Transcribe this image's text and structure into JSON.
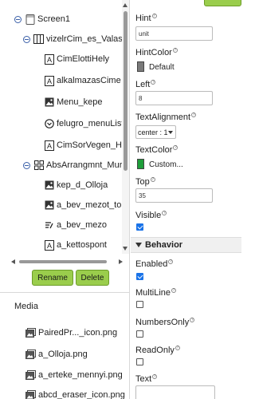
{
  "tree": {
    "screen": {
      "label": "Screen1"
    },
    "nodes": [
      {
        "label": "vizelrCim_es_Valas",
        "icon": "vertical-arrangement-icon",
        "level": 1
      },
      {
        "label": "CimElottiHely",
        "icon": "label-icon",
        "level": 2
      },
      {
        "label": "alkalmazasCime",
        "icon": "label-icon",
        "level": 2
      },
      {
        "label": "Menu_kepe",
        "icon": "image-icon",
        "level": 2
      },
      {
        "label": "felugro_menuListe",
        "icon": "listpicker-icon",
        "level": 2
      },
      {
        "label": "CimSorVegen_He",
        "icon": "label-icon",
        "level": 2
      },
      {
        "label": "AbsArrangmnt_Mur",
        "icon": "absolute-arrangement-icon",
        "level": 1
      },
      {
        "label": "kep_d_Olloja",
        "icon": "image-icon",
        "level": 2
      },
      {
        "label": "a_bev_mezot_to",
        "icon": "image-icon",
        "level": 2
      },
      {
        "label": "a_bev_mezo",
        "icon": "textbox-icon",
        "level": 2
      },
      {
        "label": "a_kettospont",
        "icon": "label-icon",
        "level": 2
      }
    ]
  },
  "buttons": {
    "rename": "Rename",
    "delete": "Delete"
  },
  "media": {
    "title": "Media",
    "items": [
      {
        "label": "PairedPr..._icon.png"
      },
      {
        "label": "a_Olloja.png"
      },
      {
        "label": "a_erteke_mennyi.png"
      },
      {
        "label": "abcd_eraser_icon.png"
      }
    ]
  },
  "props": {
    "hint": {
      "label": "Hint",
      "value": "unit"
    },
    "hintcolor": {
      "label": "HintColor",
      "value": "Default",
      "color": "#7a7a7a"
    },
    "left": {
      "label": "Left",
      "value": "8"
    },
    "textalignment": {
      "label": "TextAlignment",
      "value": "center : 1"
    },
    "textcolor": {
      "label": "TextColor",
      "value": "Custom...",
      "color": "#1e9e3a"
    },
    "top": {
      "label": "Top",
      "value": "35"
    },
    "visible": {
      "label": "Visible",
      "checked": true
    },
    "behavior": {
      "label": "Behavior"
    },
    "enabled": {
      "label": "Enabled",
      "checked": true
    },
    "multiline": {
      "label": "MultiLine",
      "checked": false
    },
    "numbersonly": {
      "label": "NumbersOnly",
      "checked": false
    },
    "readonly": {
      "label": "ReadOnly",
      "checked": false
    },
    "text": {
      "label": "Text",
      "value": ""
    }
  },
  "colors": {
    "accent_button": "#9acd4c",
    "checkbox_on": "#1a73e8"
  }
}
